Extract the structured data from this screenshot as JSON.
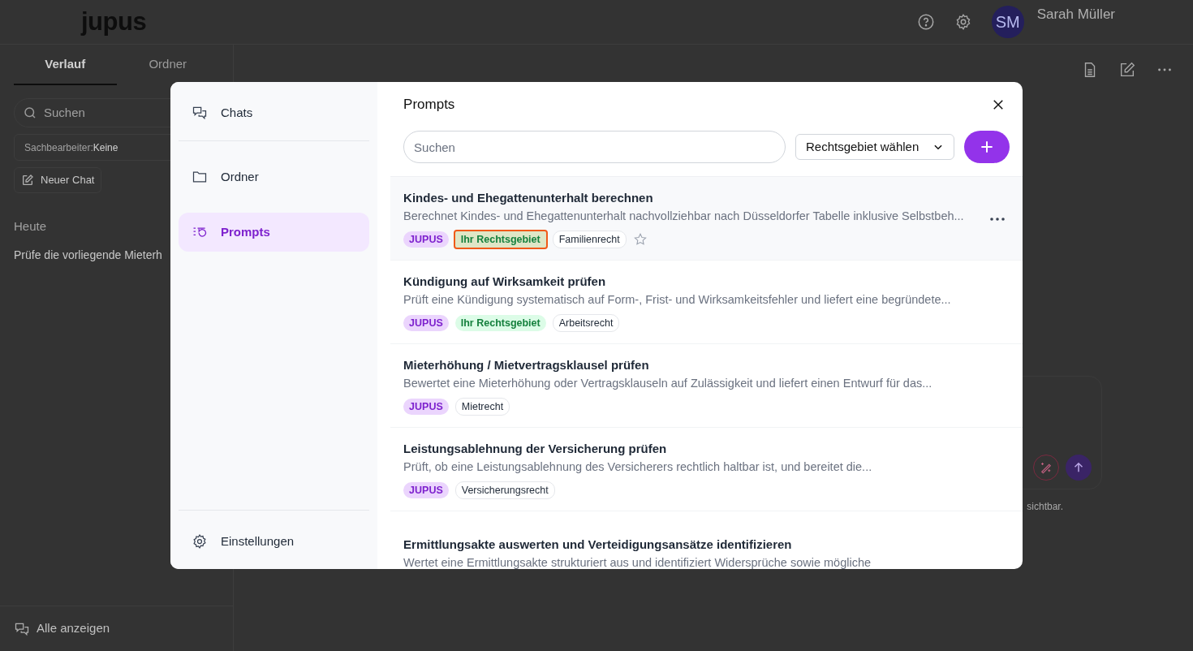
{
  "header": {
    "logo": "jupus",
    "user": {
      "initials": "SM",
      "name": "Sarah Müller"
    }
  },
  "sidebar": {
    "tabs": [
      {
        "label": "Verlauf",
        "selected": true
      },
      {
        "label": "Ordner",
        "selected": false
      }
    ],
    "search": {
      "placeholder": "Suchen"
    },
    "filter": {
      "label": "Sachbearbeiter:",
      "value": "Keine"
    },
    "new_chat": "Neuer Chat",
    "groups": [
      {
        "label": "Heute",
        "chats": [
          "Prüfe die vorliegende Mieterh"
        ]
      }
    ],
    "footer": "Alle anzeigen"
  },
  "main": {
    "note": "sichtbar."
  },
  "modal": {
    "nav": [
      {
        "label": "Chats",
        "kind": "chats",
        "selected": false
      },
      {
        "label": "Ordner",
        "kind": "folder",
        "selected": false
      },
      {
        "label": "Prompts",
        "kind": "prompts",
        "selected": true
      }
    ],
    "settings": "Einstellungen",
    "title": "Prompts",
    "search": {
      "placeholder": "Suchen"
    },
    "area_select": "Rechtsgebiet wählen",
    "prompts": [
      {
        "title": "Kindes- und Ehegattenunterhalt berechnen",
        "description": "Berechnet Kindes- und Ehegattenunterhalt nachvollziehbar nach Düsseldorfer Tabelle inklusive Selbstbeh...",
        "highlighted": true,
        "tags": [
          {
            "label": "JUPUS",
            "kind": "source",
            "outlined": false
          },
          {
            "label": "Ihr Rechtsgebiet",
            "kind": "own",
            "outlined": true
          },
          {
            "label": "Familienrecht",
            "kind": "area",
            "outlined": false
          }
        ]
      },
      {
        "title": "Kündigung auf Wirksamkeit prüfen",
        "description": "Prüft eine Kündigung systematisch auf Form-, Frist- und Wirksamkeitsfehler und liefert eine begründete...",
        "highlighted": false,
        "tags": [
          {
            "label": "JUPUS",
            "kind": "source",
            "outlined": false
          },
          {
            "label": "Ihr Rechtsgebiet",
            "kind": "own",
            "outlined": false
          },
          {
            "label": "Arbeitsrecht",
            "kind": "area",
            "outlined": false
          }
        ]
      },
      {
        "title": "Mieterhöhung / Mietvertragsklausel prüfen",
        "description": "Bewertet eine Mieterhöhung oder Vertragsklauseln auf Zulässigkeit und liefert einen Entwurf für das...",
        "highlighted": false,
        "tags": [
          {
            "label": "JUPUS",
            "kind": "source",
            "outlined": false
          },
          {
            "label": "Mietrecht",
            "kind": "area",
            "outlined": false
          }
        ]
      },
      {
        "title": "Leistungsablehnung der Versicherung prüfen",
        "description": "Prüft, ob eine Leistungsablehnung des Versicherers rechtlich haltbar ist, und bereitet die...",
        "highlighted": false,
        "tags": [
          {
            "label": "JUPUS",
            "kind": "source",
            "outlined": false
          },
          {
            "label": "Versicherungsrecht",
            "kind": "area",
            "outlined": false
          }
        ]
      },
      {
        "title": "Ermittlungsakte auswerten und Verteidigungsansätze identifizieren",
        "description": "Wertet eine Ermittlungsakte strukturiert aus und identifiziert Widersprüche sowie mögliche",
        "highlighted": false
      }
    ]
  }
}
